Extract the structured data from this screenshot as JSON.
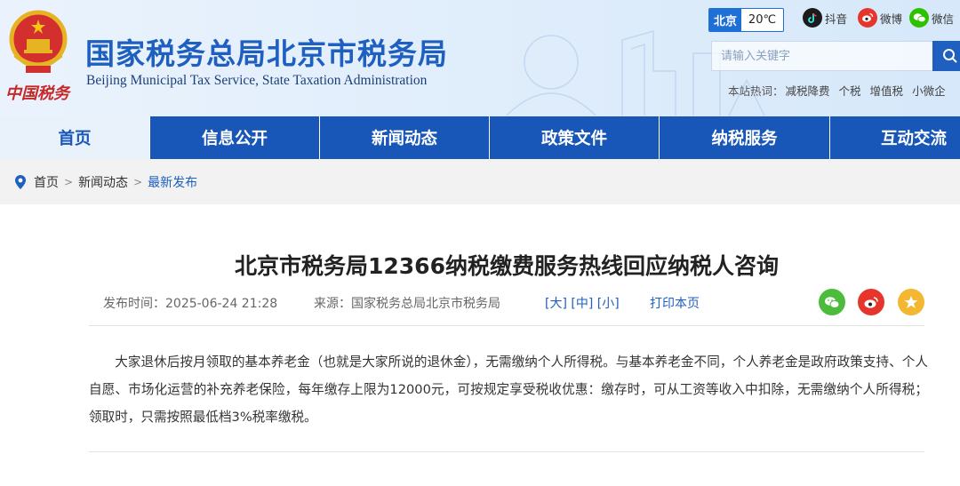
{
  "header": {
    "title": "国家税务总局北京市税务局",
    "subtitle": "Beijing Municipal Tax Service, State Taxation Administration",
    "emblem_text": "中国税务"
  },
  "weather": {
    "city": "北京",
    "temp": "20℃"
  },
  "social": {
    "douyin": "抖音",
    "weibo": "微博",
    "wechat": "微信"
  },
  "search": {
    "placeholder": "请输入关键字"
  },
  "hot": {
    "label": "本站热词：",
    "terms": [
      "减税降费",
      "个税",
      "增值税",
      "小微企"
    ]
  },
  "nav": {
    "items": [
      "首页",
      "信息公开",
      "新闻动态",
      "政策文件",
      "纳税服务",
      "互动交流"
    ],
    "active": "首页"
  },
  "breadcrumb": {
    "items": [
      "首页",
      "新闻动态",
      "最新发布"
    ],
    "separator": ">"
  },
  "article": {
    "title": "北京市税务局12366纳税缴费服务热线回应纳税人咨询",
    "date": "发布时间：2025-06-24 21:28",
    "source": "来源：国家税务总局北京市税务局",
    "font_sizes": [
      "[大]",
      "[中]",
      "[小]"
    ],
    "print": "打印本页",
    "body": "大家退休后按月领取的基本养老金（也就是大家所说的退休金），无需缴纳个人所得税。与基本养老金不同，个人养老金是政府政策支持、个人自愿、市场化运营的补充养老保险，每年缴存上限为12000元，可按规定享受税收优惠：缴存时，可从工资等收入中扣除，无需缴纳个人所得税；领取时，只需按照最低档3%税率缴税。"
  },
  "colors": {
    "brand_blue": "#1856b8",
    "title_blue": "#1e5fbf",
    "wechat_green": "#4dbb3c",
    "weibo_red": "#e6362b",
    "favorite_yellow": "#f3b731"
  }
}
